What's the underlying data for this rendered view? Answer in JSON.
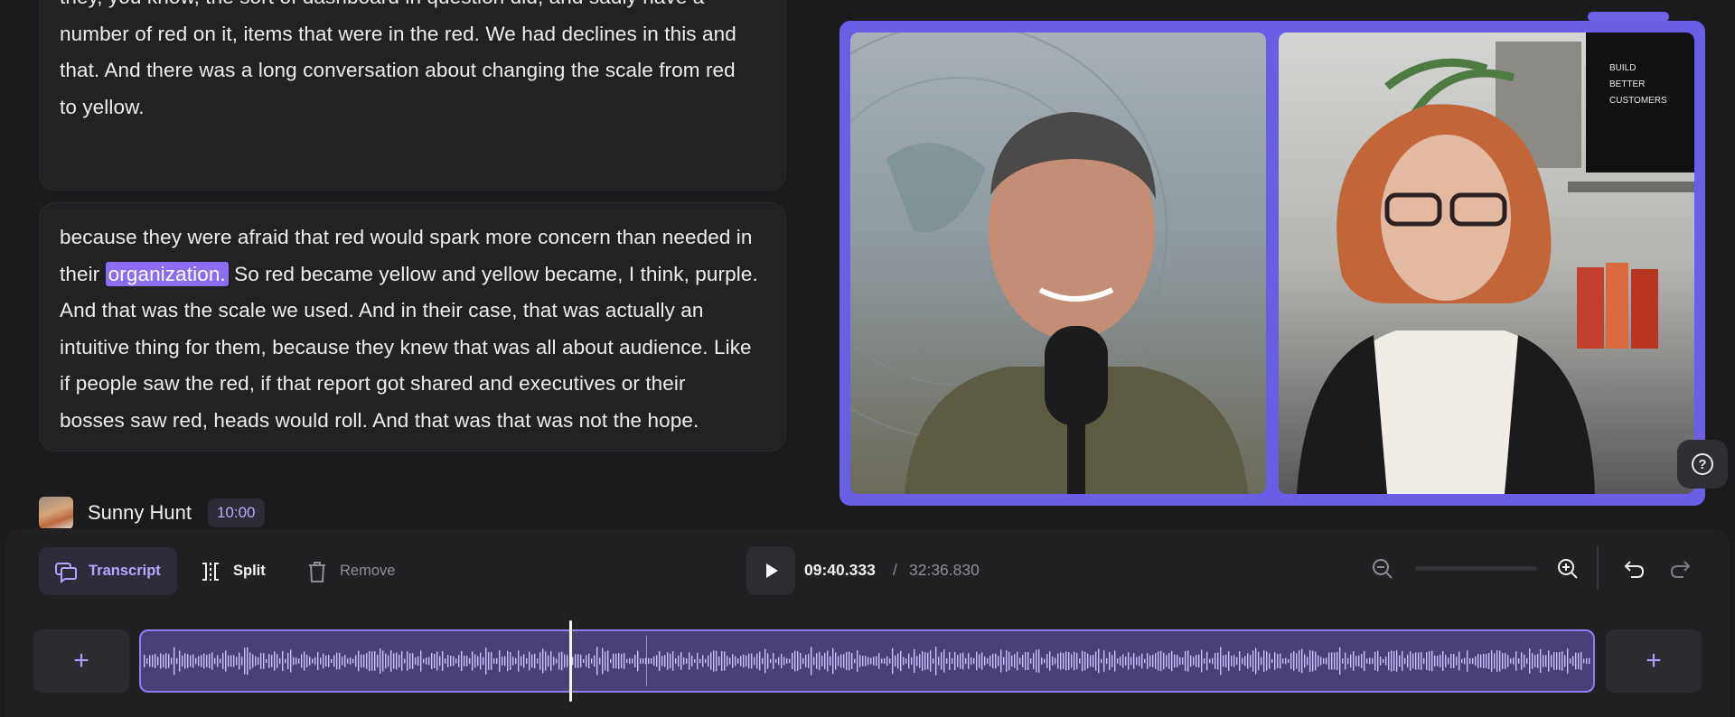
{
  "transcript": {
    "paragraph_1": [
      "they, you know, the sort of dashboard in question did, and sadly have a",
      "number of red on it, items that were in the red. We had declines in this and",
      "that. And there was a long conversation about changing the scale from red",
      "to yellow."
    ],
    "paragraph_2": {
      "line1": "because they were afraid that red would spark more concern than needed in",
      "line2_before": "their",
      "line2_highlight": "organization.",
      "line2_after": "So red became yellow and yellow became, I think, purple.",
      "line3": "And that was the scale we used. And in their case, that was actually an",
      "line4": "intuitive thing for them, because they knew that was all about audience. Like",
      "line5": "if people saw the red, if that report got shared and executives or their",
      "line6": "bosses saw red, heads would roll. And that was that was not the hope."
    },
    "next_speaker": {
      "name": "Sunny Hunt",
      "timestamp": "10:00"
    }
  },
  "video": {
    "poster_text": [
      "BUILD",
      "BETTER",
      "CUSTOMERS"
    ]
  },
  "toolbar": {
    "transcript_label": "Transcript",
    "split_label": "Split",
    "remove_label": "Remove",
    "current_time": "09:40.333",
    "separator": "/",
    "total_time": "32:36.830"
  },
  "timeline": {
    "add_left": "+",
    "add_right": "+",
    "playhead_fraction": 0.296
  },
  "help": {
    "label": "?"
  },
  "colors": {
    "accent": "#8b6cf2",
    "frame": "#6a5de6",
    "waveform_bg": "#4a4078",
    "background": "#1b1b1d"
  },
  "icons": [
    "transcript-icon",
    "split-icon",
    "trash-icon",
    "play-icon",
    "zoom-out-icon",
    "zoom-in-icon",
    "undo-icon",
    "redo-icon",
    "help-icon",
    "plus-icon"
  ]
}
